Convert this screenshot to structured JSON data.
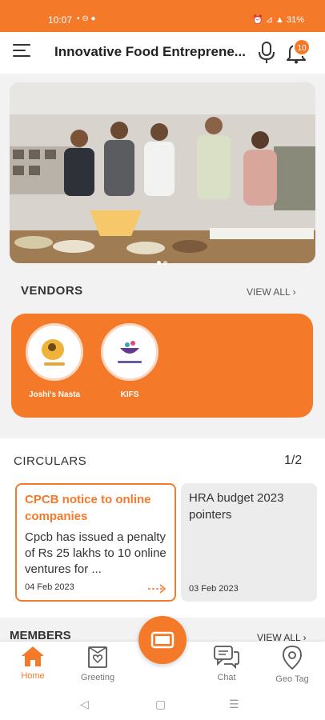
{
  "status_bar": {
    "time": "10:07",
    "indicators": "▪ ⊖ ●",
    "battery": "31%"
  },
  "header": {
    "title": "Innovative Food Entreprene...",
    "notification_count": "10",
    "icons": [
      "menu-icon",
      "mic-icon",
      "bell-icon"
    ]
  },
  "banner": {
    "slides": 2,
    "active_slide": 1
  },
  "vendors": {
    "title": "VENDORS",
    "view_all": "VIEW ALL",
    "items": [
      {
        "name": "Joshi's Nasta"
      },
      {
        "name": "KIFS"
      }
    ]
  },
  "circulars": {
    "title": "CIRCULARS",
    "pager": "1/2",
    "items": [
      {
        "title": "CPCB notice to online companies",
        "body": "Cpcb has issued a penalty of Rs 25 lakhs to 10 online ventures for ...",
        "date": "04 Feb 2023"
      },
      {
        "title": "HRA budget 2023 pointers",
        "body": "",
        "date": "03 Feb 2023"
      }
    ]
  },
  "members": {
    "title": "MEMBERS",
    "view_all": "VIEW ALL"
  },
  "bottom_nav": {
    "home": "Home",
    "greeting": "Greeting",
    "chat": "Chat",
    "geo_tag": "Geo Tag"
  },
  "colors": {
    "accent": "#f47a2a"
  }
}
